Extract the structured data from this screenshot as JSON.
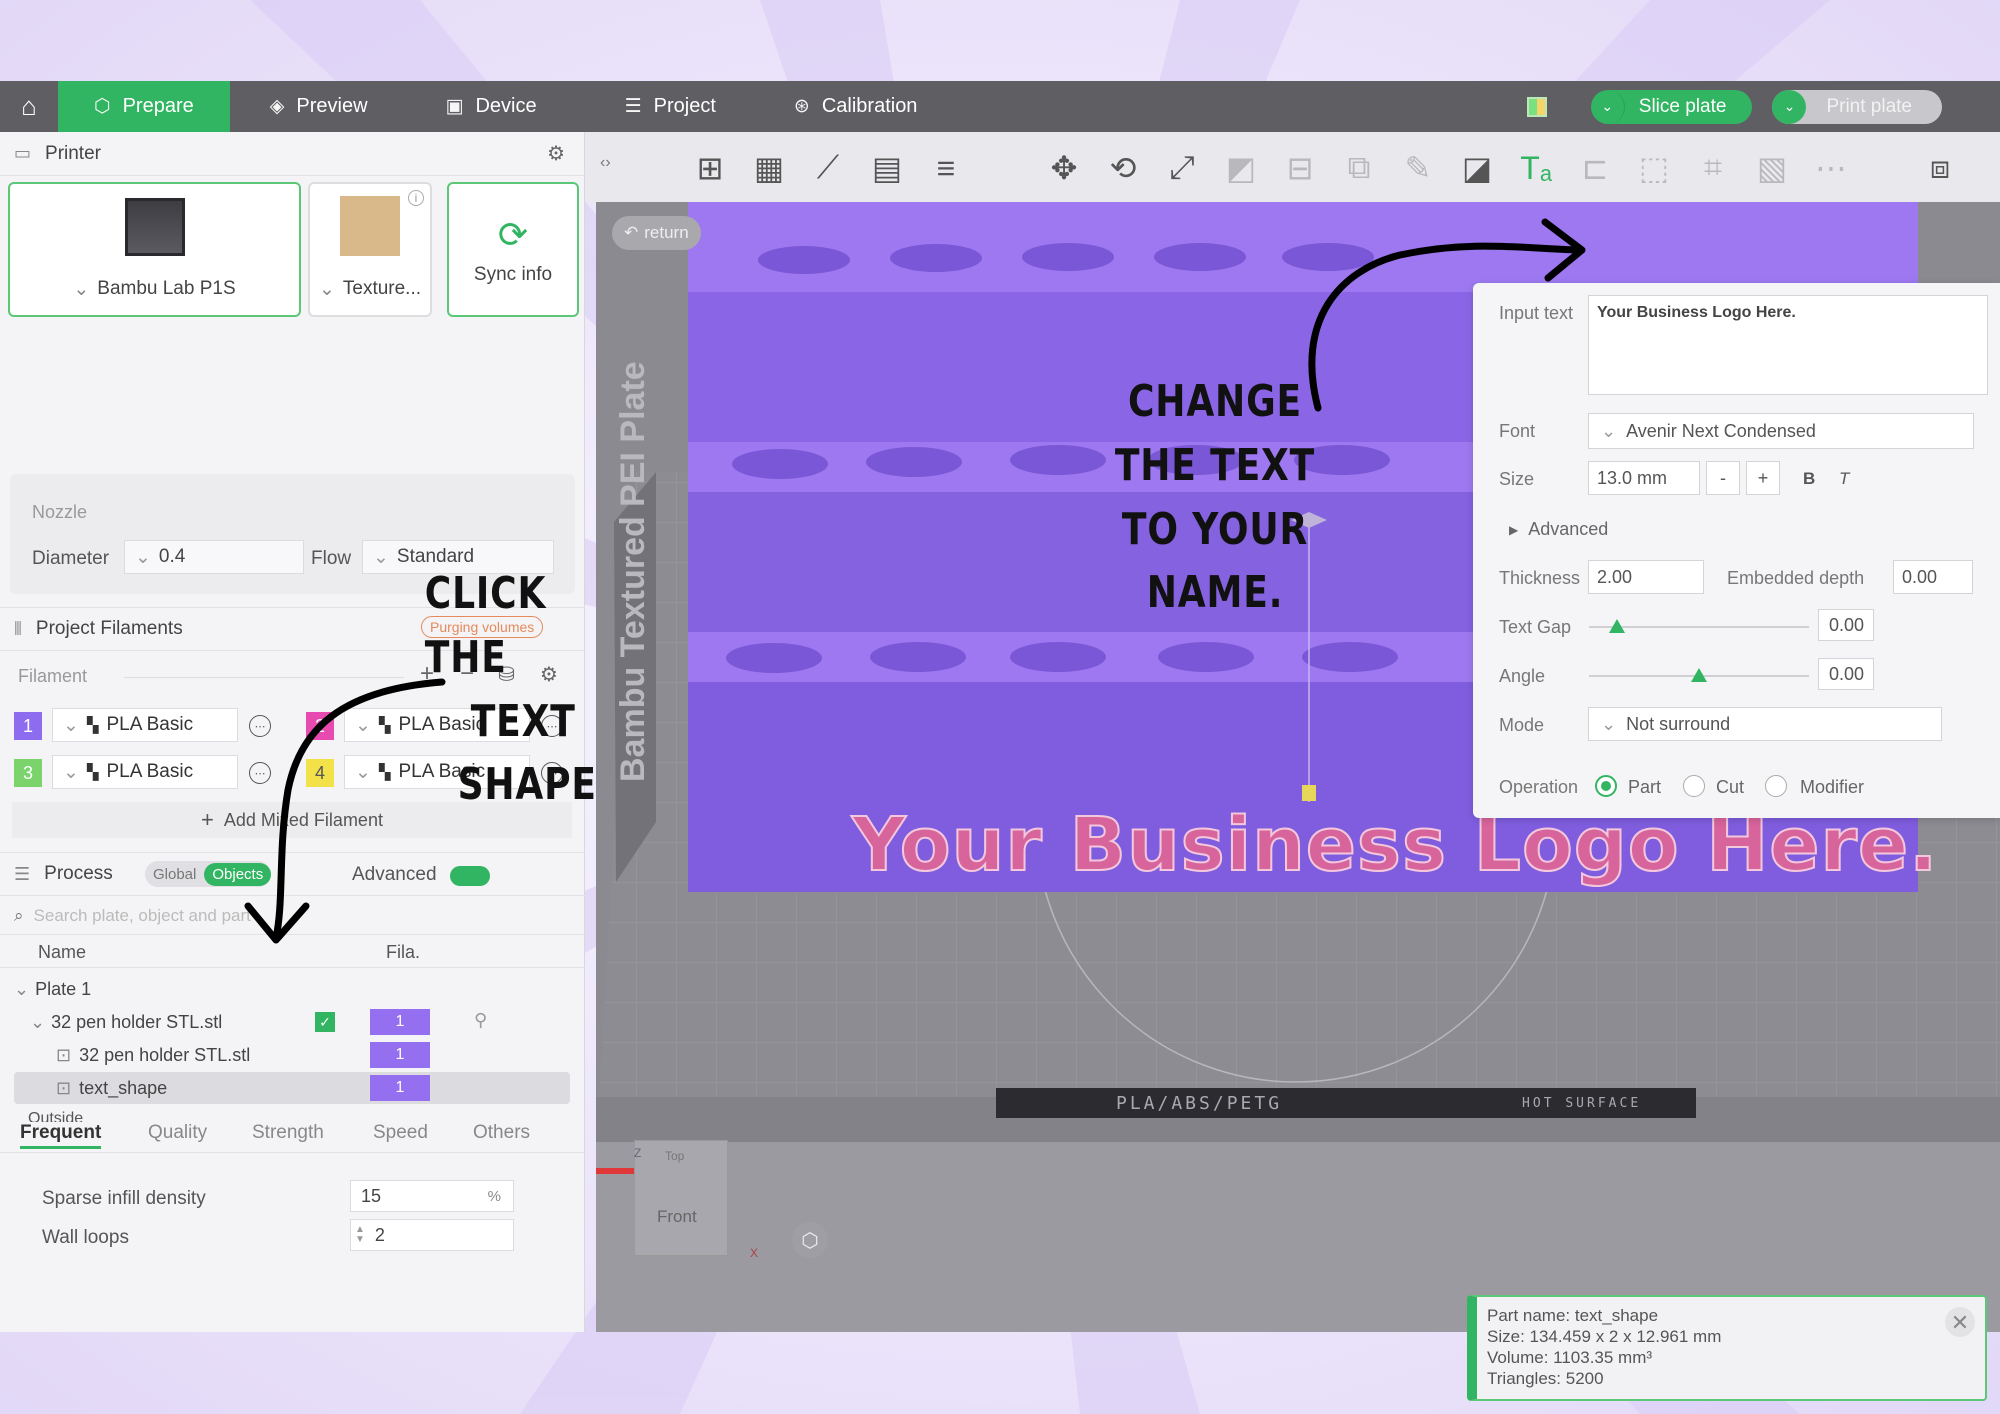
{
  "colors": {
    "accent": "#32b562",
    "topbar": "#5e5e63",
    "object": "#9470f0",
    "logo_text": "#d8649c"
  },
  "topbar": {
    "tabs": [
      {
        "label": "Prepare",
        "icon": "cube-icon"
      },
      {
        "label": "Preview",
        "icon": "layers-icon"
      },
      {
        "label": "Device",
        "icon": "device-icon"
      },
      {
        "label": "Project",
        "icon": "list-icon"
      },
      {
        "label": "Calibration",
        "icon": "target-icon"
      }
    ],
    "slice_label": "Slice plate",
    "print_label": "Print plate"
  },
  "printer": {
    "section_title": "Printer",
    "printer_name": "Bambu Lab P1S",
    "plate_name": "Texture...",
    "sync_label": "Sync info",
    "nozzle_title": "Nozzle",
    "diameter_label": "Diameter",
    "diameter_value": "0.4",
    "flow_label": "Flow",
    "flow_value": "Standard"
  },
  "filaments": {
    "section_title": "Project Filaments",
    "purging_label": "Purging volumes",
    "filament_label": "Filament",
    "items": [
      {
        "num": "1",
        "color": "#8e6cf0",
        "name": "PLA Basic"
      },
      {
        "num": "2",
        "color": "#e84bb0",
        "name": "PLA Basic"
      },
      {
        "num": "3",
        "color": "#7ad36b",
        "name": "PLA Basic"
      },
      {
        "num": "4",
        "color": "#f3e14a",
        "name": "PLA Basic"
      }
    ],
    "add_label": "Add Mixed Filament"
  },
  "process": {
    "section_title": "Process",
    "global_label": "Global",
    "objects_label": "Objects",
    "advanced_label": "Advanced",
    "search_placeholder": "Search plate, object and part",
    "col_name": "Name",
    "col_fila": "Fila.",
    "tree": [
      {
        "label": "Plate 1"
      },
      {
        "label": "32 pen holder STL.stl",
        "fila": "1"
      },
      {
        "label": "32 pen holder STL.stl",
        "fila": "1"
      },
      {
        "label": "text_shape",
        "fila": "1"
      },
      {
        "label": "Outside"
      }
    ],
    "tabs": [
      "Frequent",
      "Quality",
      "Strength",
      "Speed",
      "Others"
    ],
    "sparse_label": "Sparse infill density",
    "sparse_value": "15",
    "sparse_unit": "%",
    "wall_label": "Wall loops",
    "wall_value": "2"
  },
  "viewport": {
    "return_label": "return",
    "logo_text": "Your Business Logo Here.",
    "plate_side_text": "Bambu Textured PEI Plate",
    "bed_label": "PLA/ABS/PETG",
    "hot_label": "HOT SURFACE",
    "cube_top": "Top",
    "cube_front": "Front",
    "axis_z": "Z",
    "axis_x": "X"
  },
  "text_panel": {
    "input_label": "Input text",
    "input_value": "Your Business Logo Here.",
    "font_label": "Font",
    "font_value": "Avenir Next Condensed",
    "size_label": "Size",
    "size_value": "13.0 mm",
    "minus": "-",
    "plus": "+",
    "bold": "B",
    "italic": "T",
    "advanced_label": "Advanced",
    "thickness_label": "Thickness",
    "thickness_value": "2.00",
    "embedded_label": "Embedded depth",
    "embedded_value": "0.00",
    "gap_label": "Text Gap",
    "gap_value": "0.00",
    "angle_label": "Angle",
    "angle_value": "0.00",
    "mode_label": "Mode",
    "mode_value": "Not surround",
    "operation_label": "Operation",
    "op_part": "Part",
    "op_cut": "Cut",
    "op_modifier": "Modifier"
  },
  "info": {
    "part_name": "Part name: text_shape",
    "size": "Size: 134.459 x 2 x 12.961 mm",
    "volume": "Volume: 1103.35 mm³",
    "triangles": "Triangles: 5200"
  },
  "annotations": {
    "change_1": "CHANGE",
    "change_2": "THE TEXT",
    "change_3": "TO YOUR",
    "change_4": "NAME.",
    "click_1": "CLICK THE",
    "click_2": "TEXT",
    "click_3": "SHAPE"
  }
}
